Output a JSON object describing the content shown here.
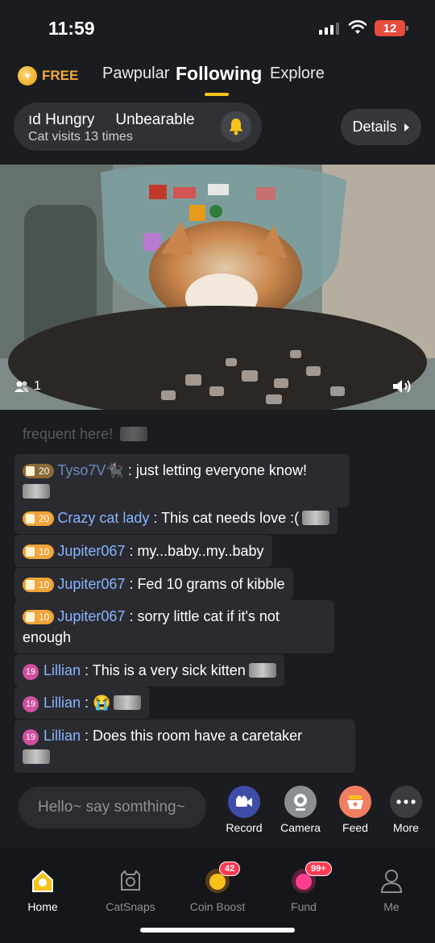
{
  "status": {
    "time": "11:59",
    "battery": "12"
  },
  "topnav": {
    "free_label": "FREE",
    "tabs": [
      {
        "label": "Pawpular",
        "active": false
      },
      {
        "label": "Following",
        "active": true
      },
      {
        "label": "Explore",
        "active": false
      }
    ]
  },
  "room": {
    "name_parts": [
      "ıd Hungry",
      "Unbearable"
    ],
    "visits": "Cat visits 13 times",
    "details_label": "Details"
  },
  "video": {
    "viewer_count": "1"
  },
  "chat": {
    "faded_line": "frequent here!",
    "messages": [
      {
        "badge": "20",
        "user": "Tyso7V🐈‍⬛",
        "text": ": just letting everyone know!",
        "thumb": true
      },
      {
        "badge": "20",
        "user": "Crazy cat lady",
        "text": ": This cat needs love :(",
        "thumb": true
      },
      {
        "badge": "10",
        "user": "Jupiter067",
        "text": ": my...baby..my..baby",
        "thumb": false
      },
      {
        "badge": "10",
        "user": "Jupiter067",
        "text": ": Fed 10 grams of kibble",
        "thumb": false
      },
      {
        "badge": "10",
        "user": "Jupiter067",
        "text": ": sorry little cat if it's not enough",
        "thumb": false
      },
      {
        "level": "19",
        "user": "Lillian",
        "text": ": This is a very sick kitten",
        "thumb": true
      },
      {
        "level": "19",
        "user": "Lillian",
        "text": ": 😭",
        "thumb": true
      },
      {
        "level": "19",
        "user": "Lillian",
        "text": ": Does this room have a caretaker",
        "thumb": true
      }
    ]
  },
  "input": {
    "placeholder": "Hello~ say somthing~"
  },
  "actions": [
    {
      "label": "Record",
      "color": "#3d4da8"
    },
    {
      "label": "Camera",
      "color": "#8b8e94"
    },
    {
      "label": "Feed",
      "color": "#f07f62"
    },
    {
      "label": "More",
      "color": "#3a3c42"
    }
  ],
  "bottom_nav": [
    {
      "label": "Home",
      "active": true
    },
    {
      "label": "CatSnaps",
      "active": false
    },
    {
      "label": "Coin Boost",
      "active": false,
      "count": "42"
    },
    {
      "label": "Fund",
      "active": false,
      "count": "99+"
    },
    {
      "label": "Me",
      "active": false
    }
  ]
}
